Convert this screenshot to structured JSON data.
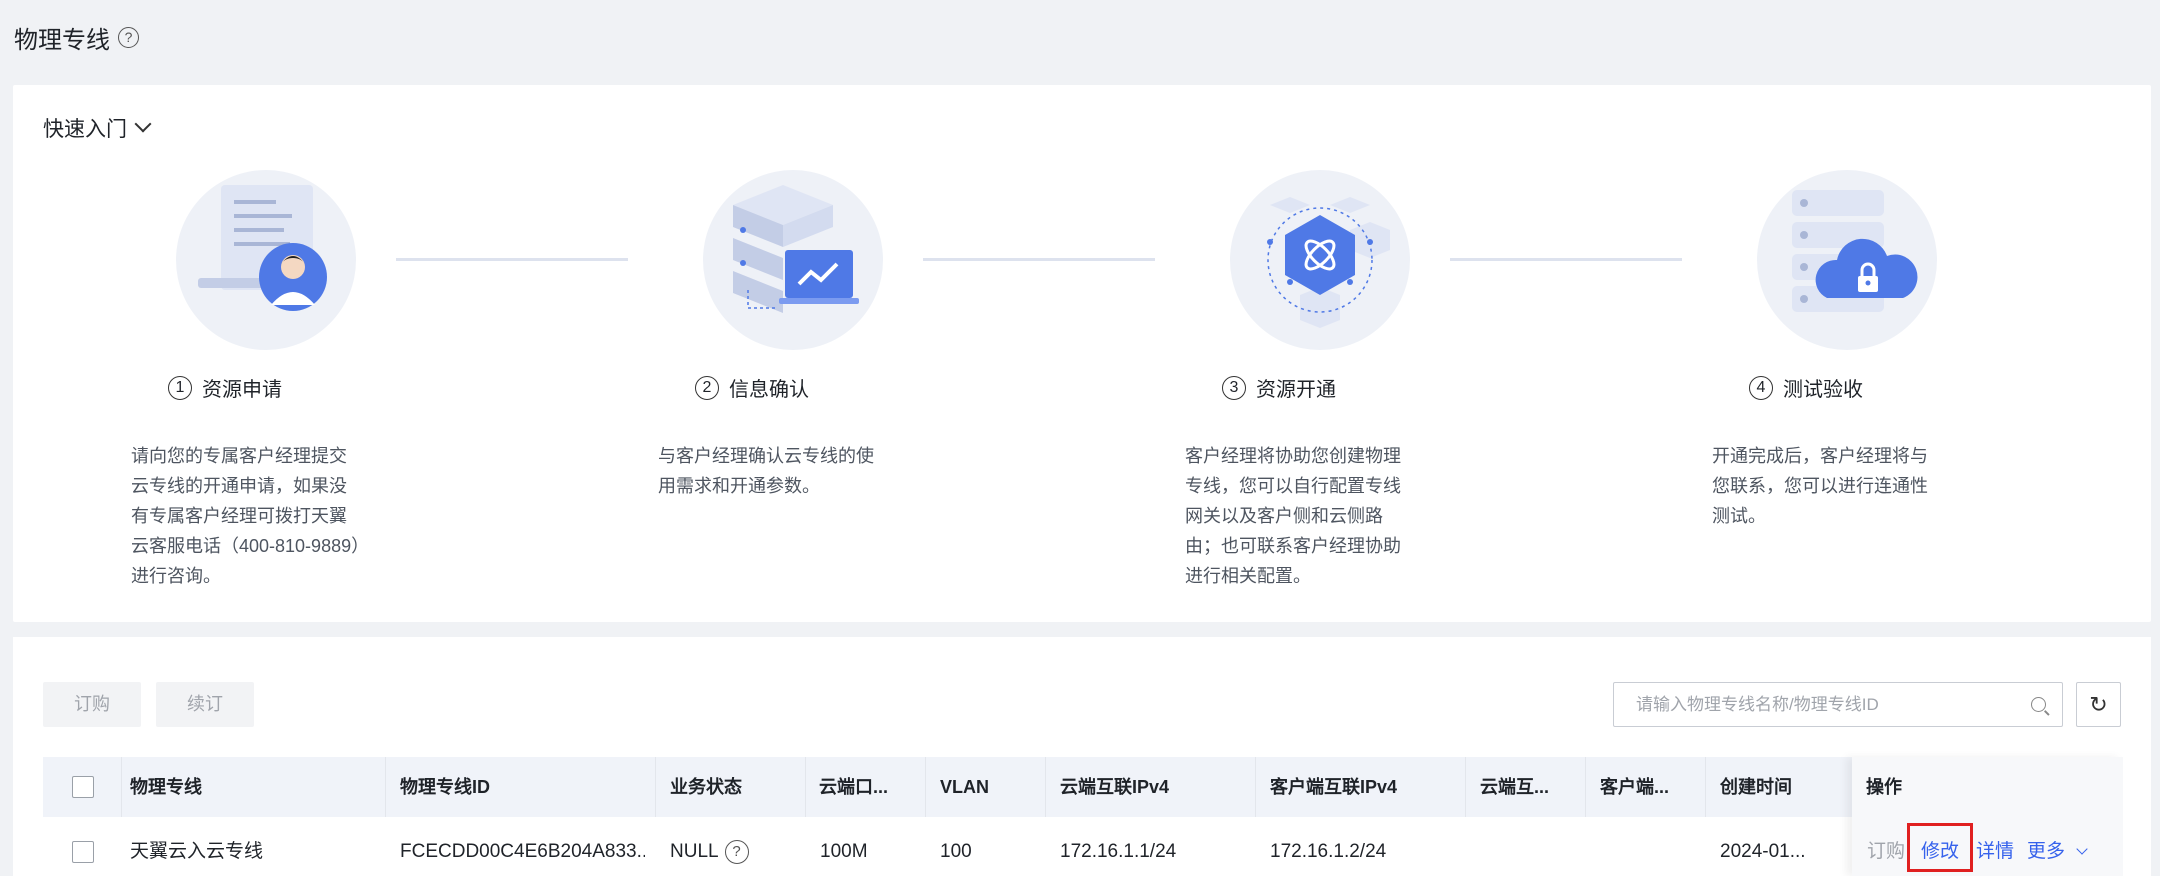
{
  "page": {
    "title": "物理专线",
    "help_icon": "?"
  },
  "quick_start": {
    "title": "快速入门",
    "steps": [
      {
        "num": "1",
        "title": "资源申请",
        "desc": "请向您的专属客户经理提交云专线的开通申请，如果没有专属客户经理可拨打天翼云客服电话（400-810-9889）进行咨询。",
        "icon": "document-user-icon"
      },
      {
        "num": "2",
        "title": "信息确认",
        "desc": "与客户经理确认云专线的使用需求和开通参数。",
        "icon": "server-chart-icon"
      },
      {
        "num": "3",
        "title": "资源开通",
        "desc": "客户经理将协助您创建物理专线，您可以自行配置专线网关以及客户侧和云侧路由；也可联系客户经理协助进行相关配置。",
        "icon": "network-cube-icon"
      },
      {
        "num": "4",
        "title": "测试验收",
        "desc": "开通完成后，客户经理将与您联系，您可以进行连通性测试。",
        "icon": "cloud-lock-icon"
      }
    ]
  },
  "toolbar": {
    "order_label": "订购",
    "renew_label": "续订",
    "search_placeholder": "请输入物理专线名称/物理专线ID"
  },
  "table": {
    "headers": [
      "物理专线",
      "物理专线ID",
      "业务状态",
      "云端口...",
      "VLAN",
      "云端互联IPv4",
      "客户端互联IPv4",
      "云端互...",
      "客户端...",
      "创建时间"
    ],
    "ops_header": "操作",
    "rows": [
      {
        "name": "天翼云入云专线",
        "id": "FCECDD00C4E6B204A833...",
        "status": "NULL",
        "port": "100M",
        "vlan": "100",
        "cloud_ipv4": "172.16.1.1/24",
        "client_ipv4": "172.16.1.2/24",
        "cloud_x": "",
        "client_x": "",
        "created": "2024-01..."
      }
    ],
    "row_ops": {
      "order": "订购",
      "modify": "修改",
      "detail": "详情",
      "more": "更多"
    }
  },
  "colors": {
    "accent": "#3662ec",
    "highlight": "#e02020"
  }
}
